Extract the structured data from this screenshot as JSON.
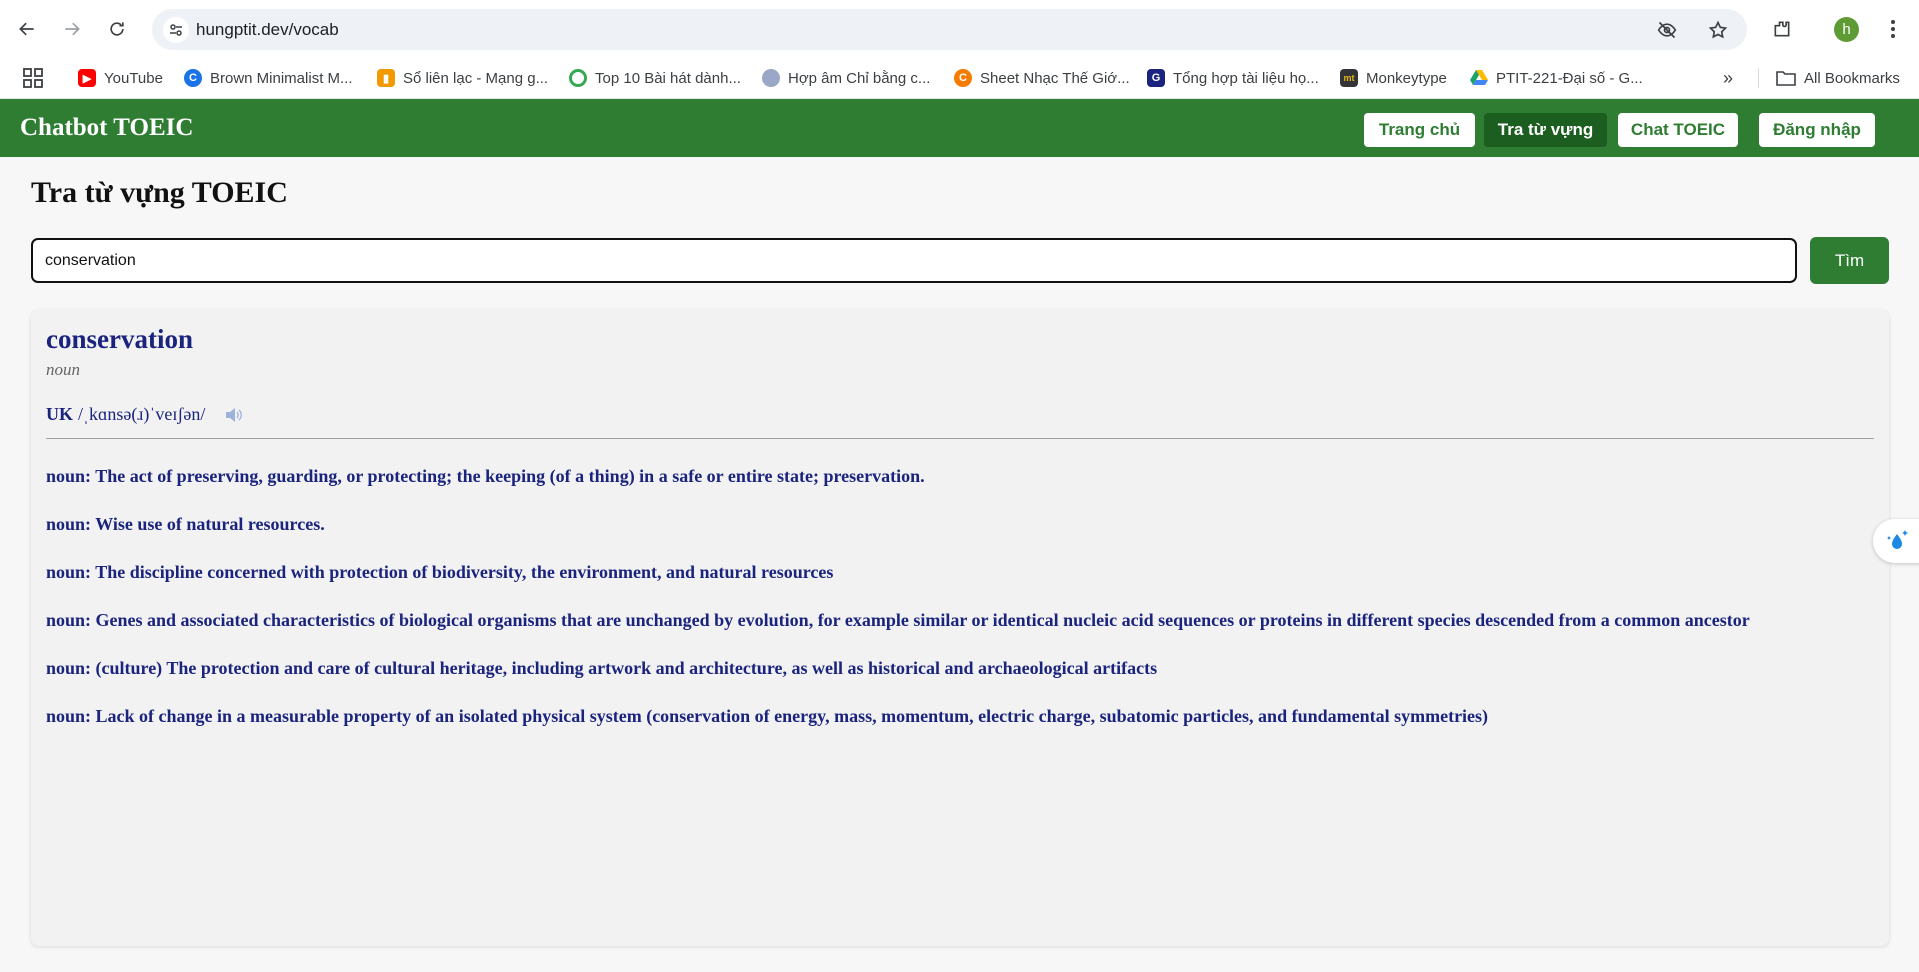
{
  "browser": {
    "url": "hungptit.dev/vocab",
    "profile_initial": "h",
    "bookmarks": [
      {
        "label": "YouTube",
        "icon": "youtube-icon",
        "color": "#ff0000"
      },
      {
        "label": "Brown Minimalist M...",
        "icon": "canva-icon",
        "color": "#1a73e8"
      },
      {
        "label": "Sổ liên lạc - Mạng g...",
        "icon": "chart-icon",
        "color": "#f29900"
      },
      {
        "label": "Top 10 Bài hát dành...",
        "icon": "ring-icon",
        "color": "#34a853"
      },
      {
        "label": "Hợp âm Chỉ bằng c...",
        "icon": "leaf-icon",
        "color": "#9aa7c7"
      },
      {
        "label": "Sheet Nhạc Thế Giớ...",
        "icon": "c-logo-icon",
        "color": "#f57c00"
      },
      {
        "label": "Tổng hợp tài liệu họ...",
        "icon": "g-logo-icon",
        "color": "#1a237e"
      },
      {
        "label": "Monkeytype",
        "icon": "monkeytype-icon",
        "color": "#323437"
      },
      {
        "label": "PTIT-221-Đại số - G...",
        "icon": "drive-icon",
        "color": "#1fa463"
      }
    ],
    "all_bookmarks_label": "All Bookmarks"
  },
  "app": {
    "brand": "Chatbot TOEIC",
    "nav": {
      "home": "Trang chủ",
      "vocab": "Tra từ vựng",
      "chat": "Chat TOEIC",
      "login": "Đăng nhập"
    },
    "accent_color": "#2e7d32"
  },
  "page": {
    "title": "Tra từ vựng TOEIC",
    "search_value": "conservation",
    "search_button": "Tìm"
  },
  "result": {
    "word": "conservation",
    "part_of_speech": "noun",
    "region": "UK",
    "ipa": "/ˌkɑnsə(ɹ)ˈveɪʃən/",
    "definitions": [
      "noun: The act of preserving, guarding, or protecting; the keeping (of a thing) in a safe or entire state; preservation.",
      "noun: Wise use of natural resources.",
      "noun: The discipline concerned with protection of biodiversity, the environment, and natural resources",
      "noun: Genes and associated characteristics of biological organisms that are unchanged by evolution, for example similar or identical nucleic acid sequences or proteins in different species descended from a common ancestor",
      "noun: (culture) The protection and care of cultural heritage, including artwork and architecture, as well as historical and archaeological artifacts",
      "noun: Lack of change in a measurable property of an isolated physical system (conservation of energy, mass, momentum, electric charge, subatomic particles, and fundamental symmetries)"
    ]
  }
}
